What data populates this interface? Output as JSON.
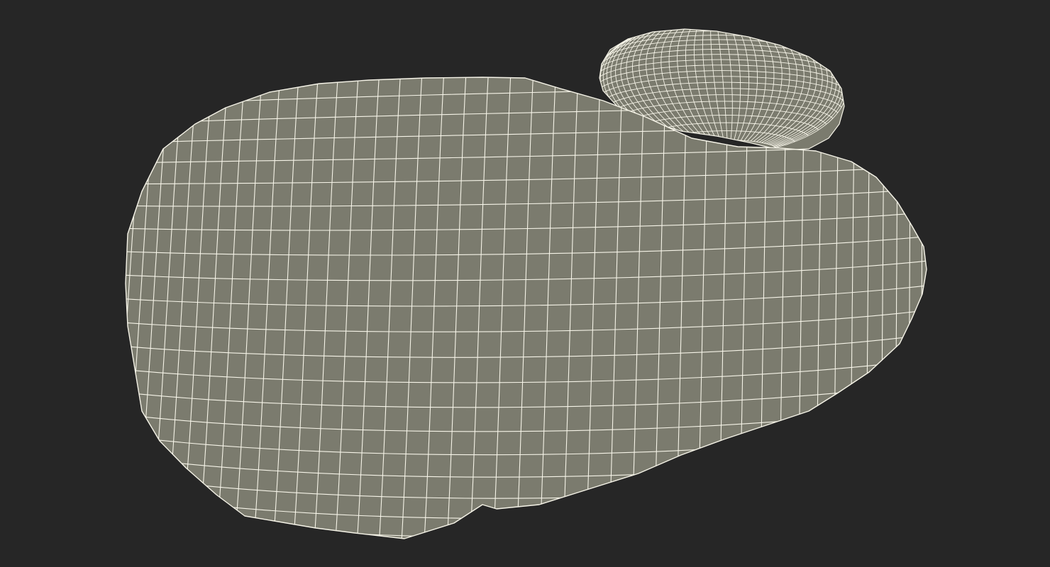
{
  "scene": {
    "background_color": "#262626",
    "surface_color": "#7b7b6e",
    "wire_color": "#f6f4e8",
    "objects": [
      {
        "id": "large-rock",
        "icon": "rock-mesh"
      },
      {
        "id": "small-pebble",
        "icon": "pebble-mesh"
      }
    ]
  }
}
